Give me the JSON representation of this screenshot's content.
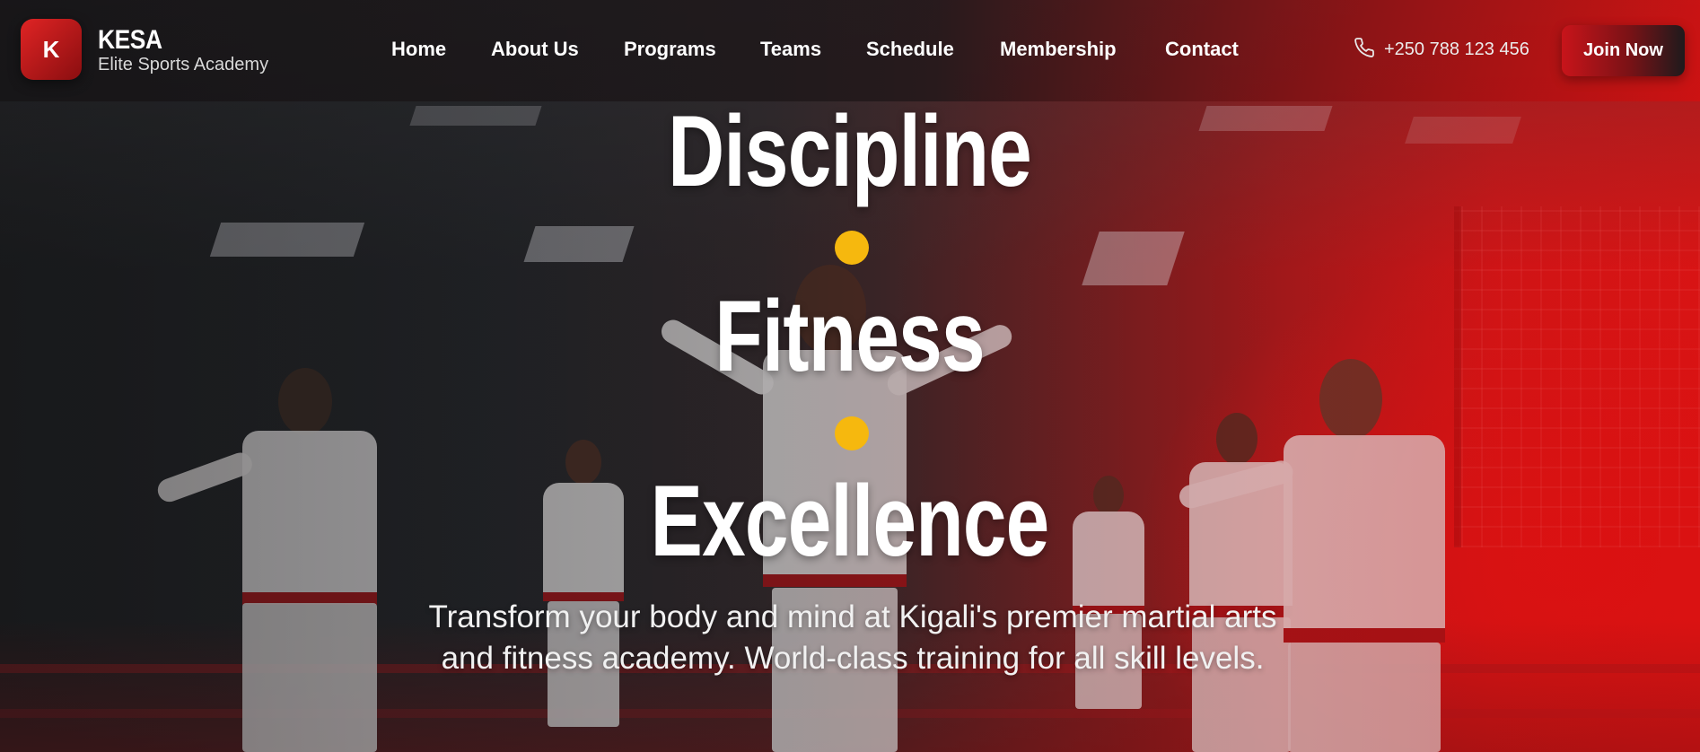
{
  "brand": {
    "logo_letter": "K",
    "name": "KESA",
    "tagline": "Elite Sports Academy"
  },
  "nav": {
    "items": [
      {
        "label": "Home"
      },
      {
        "label": "About Us"
      },
      {
        "label": "Programs"
      },
      {
        "label": "Teams"
      },
      {
        "label": "Schedule"
      },
      {
        "label": "Membership"
      },
      {
        "label": "Contact"
      }
    ],
    "phone": "+250 788 123 456",
    "phone_icon": "phone-icon",
    "cta_label": "Join Now"
  },
  "hero": {
    "words": [
      "Discipline",
      "Fitness",
      "Excellence"
    ],
    "separator": "dot-bullet",
    "subtext": "Transform your body and mind at Kigali's premier martial arts and fitness academy. World-class training for all skill levels."
  },
  "colors": {
    "accent_red": "#d4191b",
    "dot_yellow": "#f6b80e",
    "text_white": "#ffffff"
  }
}
